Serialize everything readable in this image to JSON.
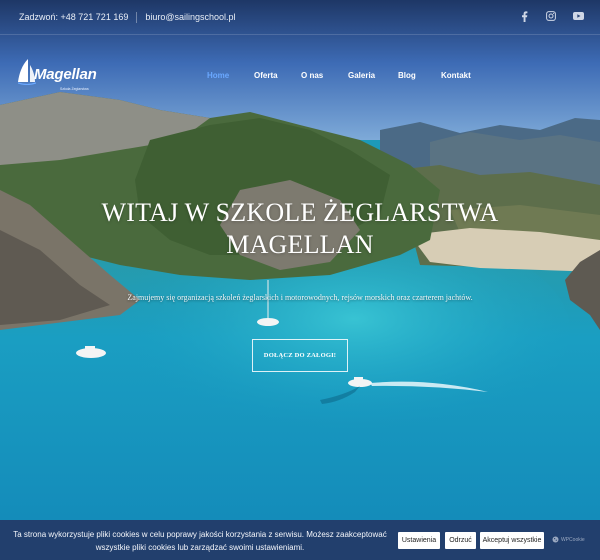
{
  "topbar": {
    "phone": "Zadzwoń: +48 721 721 169",
    "email": "biuro@sailingschool.pl",
    "social": [
      "facebook-icon",
      "instagram-icon",
      "youtube-icon"
    ]
  },
  "brand": {
    "name": "Magellan",
    "tagline": "Szkoła Żeglarstwa"
  },
  "nav": {
    "items": [
      {
        "label": "Home",
        "active": true
      },
      {
        "label": "Oferta",
        "active": false
      },
      {
        "label": "O nas",
        "active": false
      },
      {
        "label": "Galeria",
        "active": false
      },
      {
        "label": "Blog",
        "active": false
      },
      {
        "label": "Kontakt",
        "active": false
      }
    ]
  },
  "hero": {
    "title_line1": "WITAJ W SZKOLE ŻEGLARSTWA",
    "title_line2": "MAGELLAN",
    "subtitle": "Zajmujemy się organizacją szkoleń żeglarskich i motorowodnych, rejsów morskich oraz czarterem jachtów.",
    "cta": "DOŁĄCZ DO ZAŁOGI!"
  },
  "cookie": {
    "message_line1": "Ta strona wykorzystuje pliki cookies w celu poprawy jakości korzystania z serwisu. Możesz zaakceptować",
    "message_line2": "wszystkie pliki cookies lub zarządzać swoimi ustawieniami.",
    "settings_label": "Ustawienia",
    "reject_label": "Odrzuć",
    "accept_label": "Akceptuj wszystkie",
    "vendor": "WPCookie"
  },
  "colors": {
    "nav_active": "#6aa8ff",
    "cookie_bg": "#223f6d",
    "sea": "#1d9ab9"
  }
}
